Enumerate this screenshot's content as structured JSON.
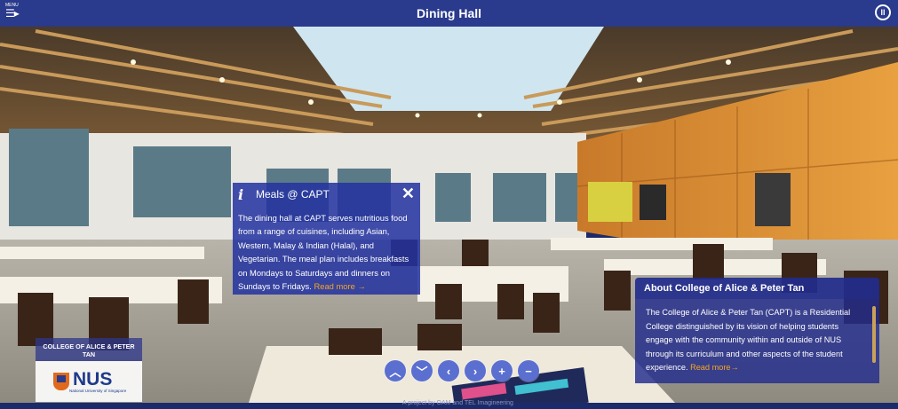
{
  "header": {
    "title": "Dining Hall",
    "menu_label": "MENU",
    "menu_icon": "hamburger-arrow-icon",
    "pause_icon": "pause-icon"
  },
  "popup": {
    "icon": "info-icon",
    "title": "Meals @ CAPT",
    "close": "✕",
    "body": "The dining hall at CAPT serves nutritious food from a range of cuisines, including Asian, Western, Malay & Indian (Halal), and Vegetarian. The meal plan includes breakfasts on Mondays to Saturdays and dinners on Sundays to Fridays.",
    "read_more": "Read more →"
  },
  "about": {
    "title": "About College of Alice & Peter Tan",
    "body": "The College of Alice & Peter Tan (CAPT) is a Residential College distinguished by its vision of helping students engage with the community within and outside of NUS through its curriculum and other aspects of the student experience.",
    "read_more": "Read more→"
  },
  "logo": {
    "college": "COLLEGE OF ALICE & PETER TAN",
    "nus": "NUS",
    "nus_sub": "National University of Singapore"
  },
  "nav": [
    {
      "name": "up-button",
      "glyph": "︿"
    },
    {
      "name": "down-button",
      "glyph": "﹀"
    },
    {
      "name": "left-button",
      "glyph": "‹"
    },
    {
      "name": "right-button",
      "glyph": "›"
    },
    {
      "name": "zoom-in-button",
      "glyph": "+"
    },
    {
      "name": "zoom-out-button",
      "glyph": "−"
    }
  ],
  "footer": {
    "text": "A project by OAM and TEL Imagineering"
  },
  "colors": {
    "bar": "#2a3a8c",
    "panel": "#2232a0",
    "accent": "#f5a623"
  }
}
